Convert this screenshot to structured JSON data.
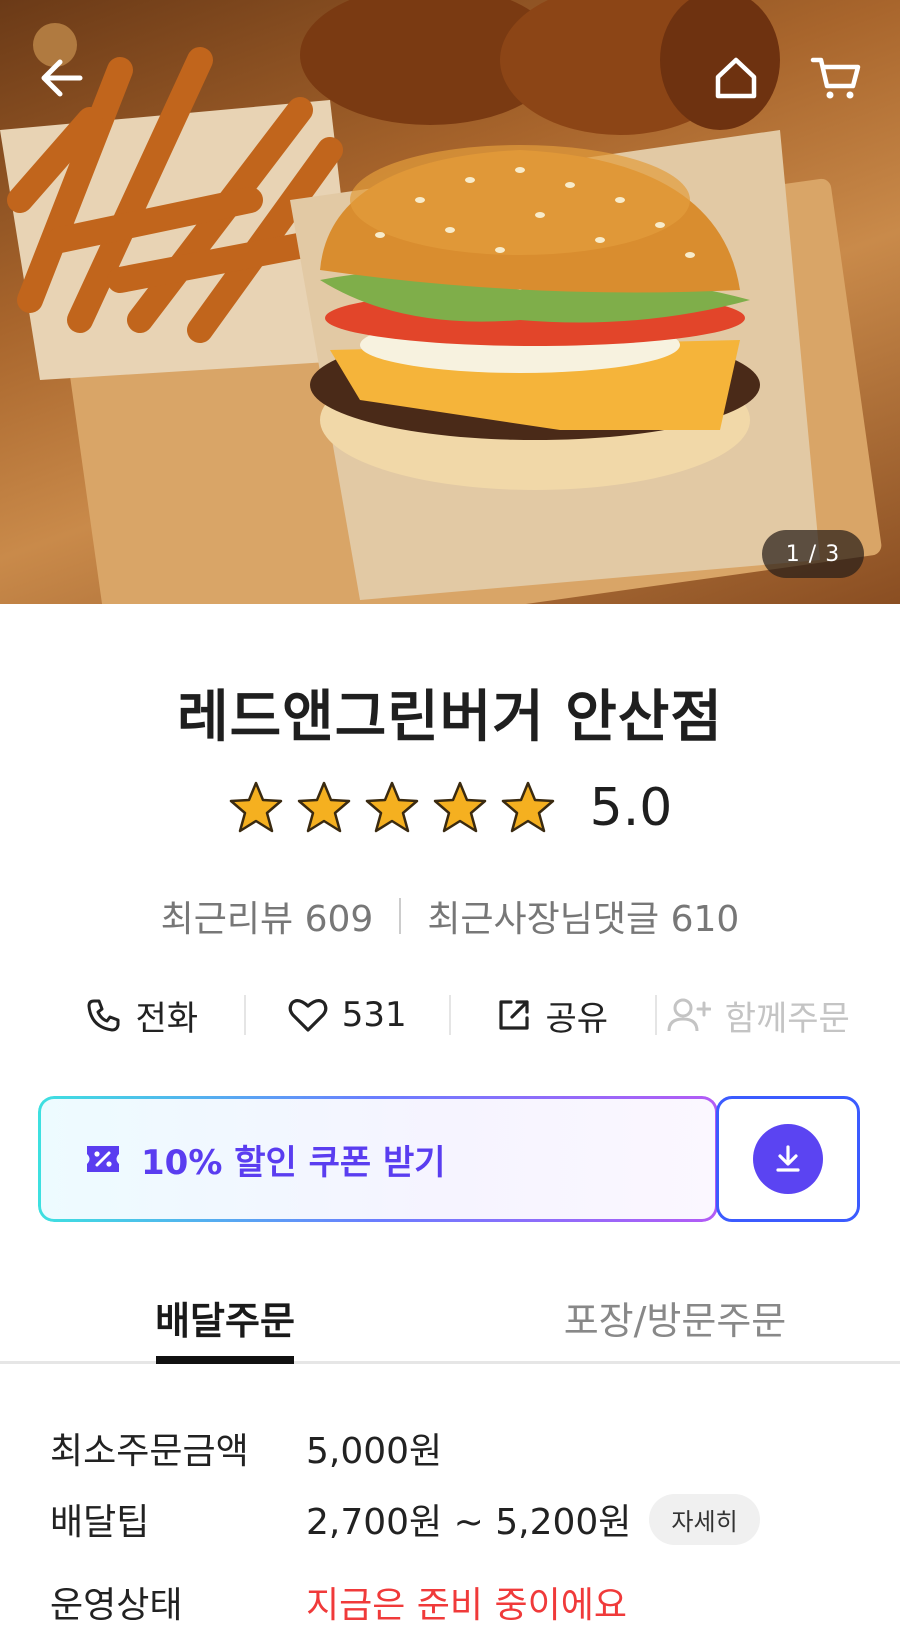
{
  "hero": {
    "pager": "1 / 3",
    "icons": {
      "back": "arrow-left-icon",
      "home": "home-icon",
      "cart": "cart-icon"
    }
  },
  "store": {
    "name": "레드앤그린버거 안산점",
    "rating": 5.0,
    "rating_text": "5.0",
    "stars": 5,
    "recent_reviews": "최근리뷰 609",
    "recent_owner_replies": "최근사장님댓글 610"
  },
  "actions": {
    "call": "전화",
    "likes": "531",
    "share": "공유",
    "group_order": "함께주문"
  },
  "coupon": {
    "label": "10% 할인 쿠폰 받기",
    "colors": {
      "text": "#5a3df0",
      "button": "#5b44f2",
      "border_start": "#3ee0e0",
      "border_end": "#b35bf5"
    }
  },
  "tabs": [
    {
      "label": "배달주문",
      "active": true
    },
    {
      "label": "포장/방문주문",
      "active": false
    }
  ],
  "details": {
    "min_order_label": "최소주문금액",
    "min_order_value": "5,000원",
    "delivery_tip_label": "배달팁",
    "delivery_tip_value": "2,700원 ~ 5,200원",
    "delivery_tip_more": "자세히",
    "status_label": "운영상태",
    "status_value": "지금은 준비 중이에요",
    "status_color": "#f03a3a"
  }
}
